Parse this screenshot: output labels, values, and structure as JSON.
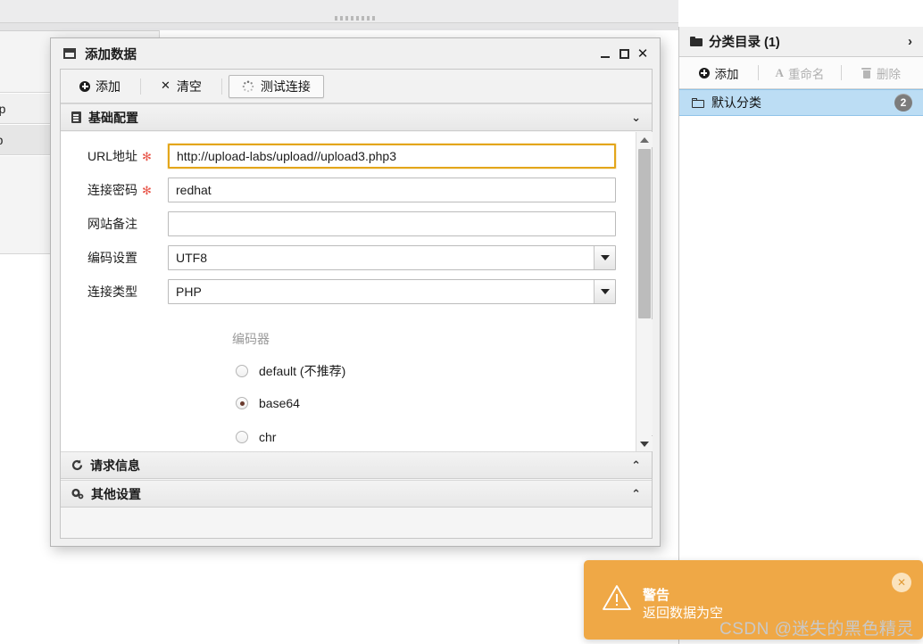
{
  "background": {
    "rows": [
      {
        "text": "php"
      },
      {
        "text": "php"
      }
    ]
  },
  "dialog": {
    "title": "添加数据",
    "icon": "window-icon",
    "window_controls": {
      "minimize": "minimize-icon",
      "maximize": "maximize-icon",
      "close": "✕"
    },
    "toolbar": {
      "add_label": "添加",
      "clear_label": "清空",
      "test_connection_label": "测试连接"
    },
    "sections": [
      {
        "id": "basic",
        "title": "基础配置",
        "icon": "document-icon",
        "chevron": "⌄",
        "expanded": true
      },
      {
        "id": "request",
        "title": "请求信息",
        "icon": "refresh-icon",
        "chevron": "⌃",
        "expanded": false
      },
      {
        "id": "other",
        "title": "其他设置",
        "icon": "gears-icon",
        "chevron": "⌃",
        "expanded": false
      }
    ],
    "form": {
      "fields": [
        {
          "label": "URL地址",
          "required": true,
          "value": "http://upload-labs/upload//upload3.php3",
          "type": "text",
          "focused": true
        },
        {
          "label": "连接密码",
          "required": true,
          "value": "redhat",
          "type": "text",
          "focused": false
        },
        {
          "label": "网站备注",
          "required": false,
          "value": "",
          "type": "text",
          "focused": false
        },
        {
          "label": "编码设置",
          "required": false,
          "value": "UTF8",
          "type": "select",
          "focused": false
        },
        {
          "label": "连接类型",
          "required": false,
          "value": "PHP",
          "type": "select",
          "focused": false
        }
      ],
      "encoder_group_label": "编码器",
      "encoder_options": [
        {
          "label": "default (不推荐)",
          "checked": false
        },
        {
          "label": "base64",
          "checked": true
        },
        {
          "label": "chr",
          "checked": false
        }
      ]
    }
  },
  "sidebar": {
    "header_title": "分类目录 (1)",
    "header_icon": "folder-icon",
    "collapse_icon": "›",
    "toolbar": {
      "add_label": "添加",
      "rename_label": "重命名",
      "delete_label": "删除"
    },
    "items": [
      {
        "label": "默认分类",
        "badge": "2",
        "selected": true
      }
    ]
  },
  "toast": {
    "title": "警告",
    "message": "返回数据为空",
    "close_label": "✕",
    "icon": "warning-triangle-icon",
    "color": "#efa846"
  },
  "watermark": "CSDN @迷失的黑色精灵"
}
